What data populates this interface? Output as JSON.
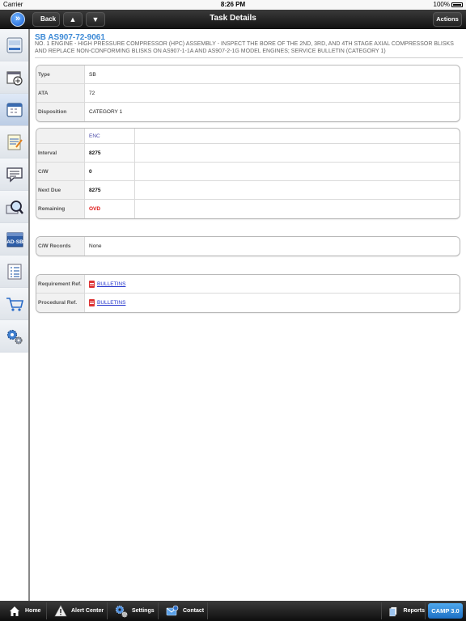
{
  "status": {
    "carrier": "Carrier",
    "time": "8:26 PM",
    "battery": "100%"
  },
  "nav": {
    "back_label": "Back",
    "up_glyph": "▲",
    "down_glyph": "▼",
    "title": "Task Details",
    "actions_label": "Actions",
    "menu_glyph": "»"
  },
  "sidebar": {
    "items": [
      {
        "name": "overview-icon",
        "label": "Overview"
      },
      {
        "name": "aircraft-calendar-icon"
      },
      {
        "name": "calendar-icon"
      },
      {
        "name": "notepad-icon"
      },
      {
        "name": "chat-icon"
      },
      {
        "name": "magnifier-icon"
      },
      {
        "name": "ad-sb-icon",
        "label": "AD·SB"
      },
      {
        "name": "list-icon"
      },
      {
        "name": "cart-icon"
      },
      {
        "name": "settings-gears-icon"
      }
    ]
  },
  "task": {
    "title": "SB AS907-72-9061",
    "description": "NO. 1 ENGINE - HIGH PRESSURE COMPRESSOR (HPC) ASSEMBLY - INSPECT THE BORE OF THE 2ND, 3RD, AND 4TH STAGE AXIAL COMPRESSOR BLISKS AND REPLACE NON-CONFORMING BLISKS ON AS907-1-1A AND AS907-2-1G MODEL ENGINES; SERVICE BULLETIN (CATEGORY 1)"
  },
  "info": {
    "type_label": "Type",
    "type_value": "SB",
    "ata_label": "ATA",
    "ata_value": "72",
    "disposition_label": "Disposition",
    "disposition_value": "CATEGORY 1"
  },
  "intervals": {
    "column_header": "ENC",
    "interval_label": "Interval",
    "interval_value": "8275",
    "cw_label": "C/W",
    "cw_value": "0",
    "next_due_label": "Next Due",
    "next_due_value": "8275",
    "remaining_label": "Remaining",
    "remaining_value": "OVD"
  },
  "records": {
    "label": "C/W Records",
    "value": "None"
  },
  "refs": {
    "requirement_label": "Requirement Ref.",
    "requirement_link": "BULLETINS",
    "procedural_label": "Procedural Ref.",
    "procedural_link": "BULLETINS"
  },
  "tabbar": {
    "home": "Home",
    "alert_center": "Alert Center",
    "settings": "Settings",
    "contact": "Contact",
    "reports": "Reports",
    "camp": "CAMP 3.0"
  },
  "colors": {
    "title_blue": "#3d8ad6",
    "overdue_red": "#dd1111",
    "link_blue": "#2233cc"
  }
}
